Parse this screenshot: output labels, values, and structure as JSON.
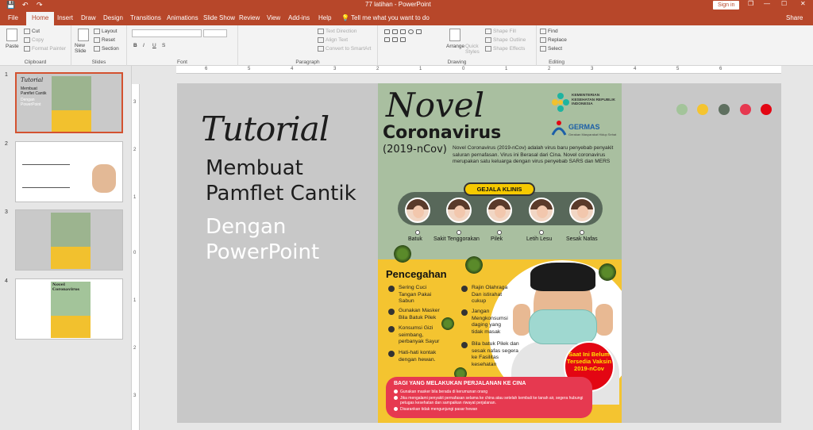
{
  "titlebar": {
    "title": "77 latihan  -  PowerPoint",
    "sign_in": "Sign in",
    "restore": "❐",
    "minimize": "—",
    "maximize": "☐",
    "close": "✕",
    "save": "💾",
    "undo": "↶",
    "redo": "↷"
  },
  "tabs": [
    "File",
    "Home",
    "Insert",
    "Draw",
    "Design",
    "Transitions",
    "Animations",
    "Slide Show",
    "Review",
    "View",
    "Add-ins",
    "Help"
  ],
  "tell_me": "Tell me what you want to do",
  "share": "Share",
  "ribbon": {
    "clipboard": {
      "paste": "Paste",
      "cut": "Cut",
      "copy": "Copy",
      "format_painter": "Format Painter",
      "label": "Clipboard"
    },
    "slides": {
      "new_slide": "New Slide",
      "layout": "Layout",
      "reset": "Reset",
      "section": "Section",
      "label": "Slides"
    },
    "font": {
      "bold": "B",
      "italic": "I",
      "underline": "U",
      "strike": "S",
      "label": "Font"
    },
    "paragraph": {
      "text_direction": "Text Direction",
      "align_text": "Align Text",
      "convert_smartart": "Convert to SmartArt",
      "label": "Paragraph"
    },
    "drawing": {
      "arrange": "Arrange",
      "quick_styles": "Quick Styles",
      "shape_fill": "Shape Fill",
      "shape_outline": "Shape Outline",
      "shape_effects": "Shape Effects",
      "label": "Drawing"
    },
    "editing": {
      "find": "Find",
      "replace": "Replace",
      "select": "Select",
      "label": "Editing"
    }
  },
  "thumbnails": [
    {
      "num": "1",
      "title": "Tutorial",
      "lines": [
        "Membuat",
        "Pamflet Cantik",
        "Dengan",
        "PowerPoint"
      ]
    },
    {
      "num": "2"
    },
    {
      "num": "3"
    },
    {
      "num": "4",
      "title": "Novel Coronavirus"
    }
  ],
  "ruler": {
    "h": [
      "6",
      "5",
      "4",
      "3",
      "2",
      "1",
      "0",
      "1",
      "2",
      "3",
      "4",
      "5",
      "6"
    ],
    "v": [
      "3",
      "2",
      "1",
      "0",
      "1",
      "2",
      "3"
    ]
  },
  "slide": {
    "tutorial": "Tutorial",
    "line1": "Membuat",
    "line2": "Pamflet Cantik",
    "line3": "Dengan",
    "line4": "PowerPoint",
    "dots": [
      "#a3c49a",
      "#f4c430",
      "#5f7060",
      "#e63950",
      "#e30613"
    ],
    "poster": {
      "novel": "Novel",
      "corona": "Coronavirus",
      "year": "(2019-nCov)",
      "desc": "Novel Coronavirus (2019-nCov) adalah virus baru penyebab penyakit saluran pernafasan. Virus ini Berasal dari Cina. Novel coronavirus merupakan satu keluarga dengan virus penyebab SARS dan MERS",
      "kemenkes": "KEMENTERIAN KESEHATAN REPUBLIK INDONESIA",
      "germas": "GERMAS",
      "germas_sub": "Gerakan Masyarakat Hidup Sehat",
      "gejala": "GEJALA KLINIS",
      "symptoms": [
        "Batuk",
        "Sakit Tenggorakan",
        "Pilek",
        "Letih Lesu",
        "Sesak Nafas"
      ],
      "pencegahan": "Pencegahan",
      "prevention_left": [
        "Sering Cuci Tangan Pakai Sabun",
        "Gunakan Masker Bila Batuk Pilek",
        "Konsumsi Gizi seimbang, perbanyak Sayur",
        "Hati-hati kontak dengan hewan."
      ],
      "prevention_right": [
        "Rajin Olahraga Dan istirahat cukup",
        "Jangan Mengkonsumsi daging yang tidak masak",
        "Bila batuk Pilek dan sesak nafas segera ke Fasilitas kesehatan"
      ],
      "vaksin": "Saat Ini Belum Tersedia Vaksin 2019-nCov",
      "travel_title": "BAGI YANG MELAKUKAN PERJALANAN KE CINA",
      "travel_lines": [
        "Gunakan masker bila berada di kerumunan orang",
        "Jika mengalami penyakit pernafasan selama ke china atau setelah kembali ke tanah air, segera hubungi petugas kesehatan dan sampaikan riwayat perjalanan.",
        "Disarankan tidak mengunjungi pasar hewan"
      ]
    }
  }
}
